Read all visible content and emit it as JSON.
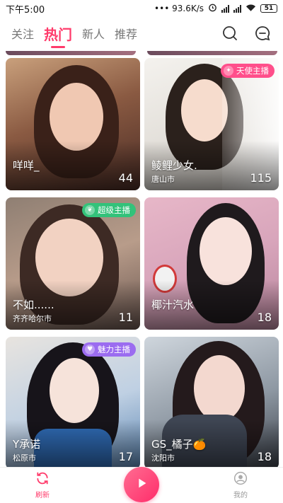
{
  "status_bar": {
    "time": "下午5:00",
    "network_speed": "93.6K/s",
    "battery": "51"
  },
  "tabs": [
    {
      "label": "关注",
      "active": false
    },
    {
      "label": "热门",
      "active": true
    },
    {
      "label": "新人",
      "active": false
    },
    {
      "label": "推荐",
      "active": false
    }
  ],
  "header_icons": [
    "search-icon",
    "message-icon"
  ],
  "cards": [
    {
      "name": "咩咩_",
      "city": "",
      "count": "44",
      "badge": null
    },
    {
      "name": "鲮鲤少女.",
      "city": "唐山市",
      "count": "115",
      "badge": {
        "label": "天使主播",
        "color": "#ff4f8b",
        "icon": "wing-icon"
      }
    },
    {
      "name": "不如......",
      "city": "齐齐哈尔市",
      "count": "11",
      "badge": {
        "label": "超级主播",
        "color": "#33c27a",
        "icon": "leaf-icon"
      }
    },
    {
      "name": "椰汁汽水",
      "city": "",
      "count": "18",
      "badge": null
    },
    {
      "name": "Y承诺",
      "city": "松原市",
      "count": "17",
      "badge": {
        "label": "魅力主播",
        "color": "#9b6cf0",
        "icon": "heart-icon"
      }
    },
    {
      "name": "GS_橘子🍊",
      "city": "沈阳市",
      "count": "18",
      "badge": null
    }
  ],
  "bottom_nav": {
    "refresh_label": "刷新",
    "me_label": "我的",
    "accent_color": "#ff3b6b"
  }
}
